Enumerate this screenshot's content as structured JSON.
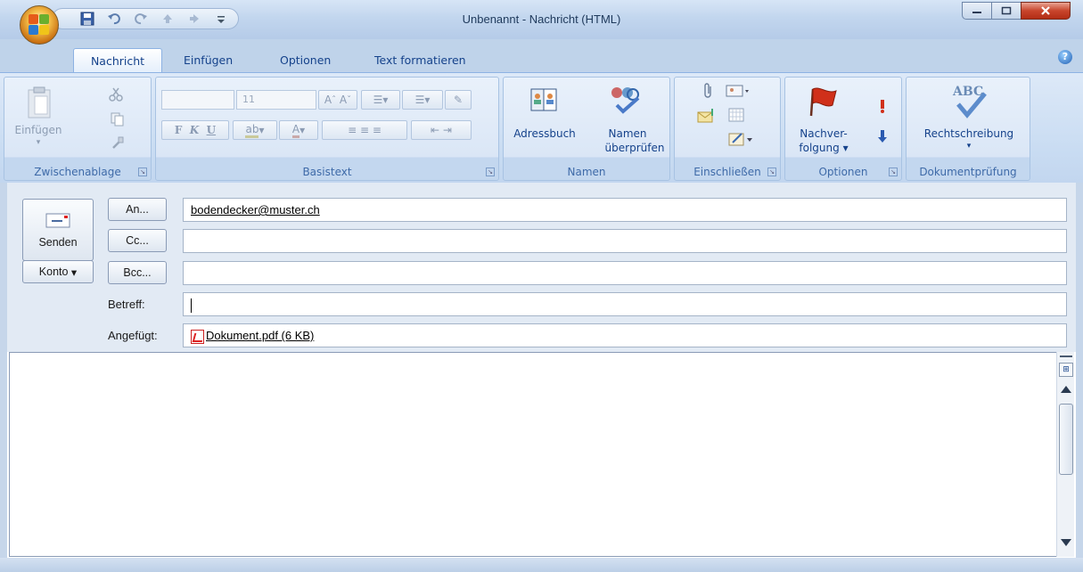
{
  "window": {
    "title": "Unbenannt - Nachricht (HTML)"
  },
  "quick_access": {
    "items": [
      "save-icon",
      "undo-icon",
      "redo-icon",
      "up-icon",
      "down-icon",
      "customize-icon"
    ]
  },
  "tabs": [
    {
      "label": "Nachricht",
      "active": true
    },
    {
      "label": "Einfügen",
      "active": false
    },
    {
      "label": "Optionen",
      "active": false
    },
    {
      "label": "Text formatieren",
      "active": false
    }
  ],
  "ribbon": {
    "clipboard": {
      "label": "Zwischenablage",
      "paste_label": "Einfügen"
    },
    "basic_text": {
      "label": "Basistext",
      "font_name": "",
      "font_size": "11"
    },
    "names": {
      "label": "Namen",
      "address_book": "Adressbuch",
      "check_names_1": "Namen",
      "check_names_2": "überprüfen"
    },
    "include": {
      "label": "Einschließen"
    },
    "options": {
      "label": "Optionen",
      "followup_1": "Nachver-",
      "followup_2": "folgung"
    },
    "proofing": {
      "label": "Dokumentprüfung",
      "spelling": "Rechtschreibung",
      "abc": "ABC"
    }
  },
  "compose": {
    "send_label": "Senden",
    "account_label": "Konto",
    "to_button": "An...",
    "cc_button": "Cc...",
    "bcc_button": "Bcc...",
    "to_value": "bodendecker@muster.ch",
    "cc_value": "",
    "bcc_value": "",
    "subject_label": "Betreff:",
    "subject_value": "",
    "attached_label": "Angefügt:",
    "attachment": "Dokument.pdf (6 KB)"
  },
  "body": {
    "text": ""
  },
  "colors": {
    "ribbon_text": "#15428b",
    "frame": "#c6d6ea",
    "close_button": "#c8452c"
  }
}
